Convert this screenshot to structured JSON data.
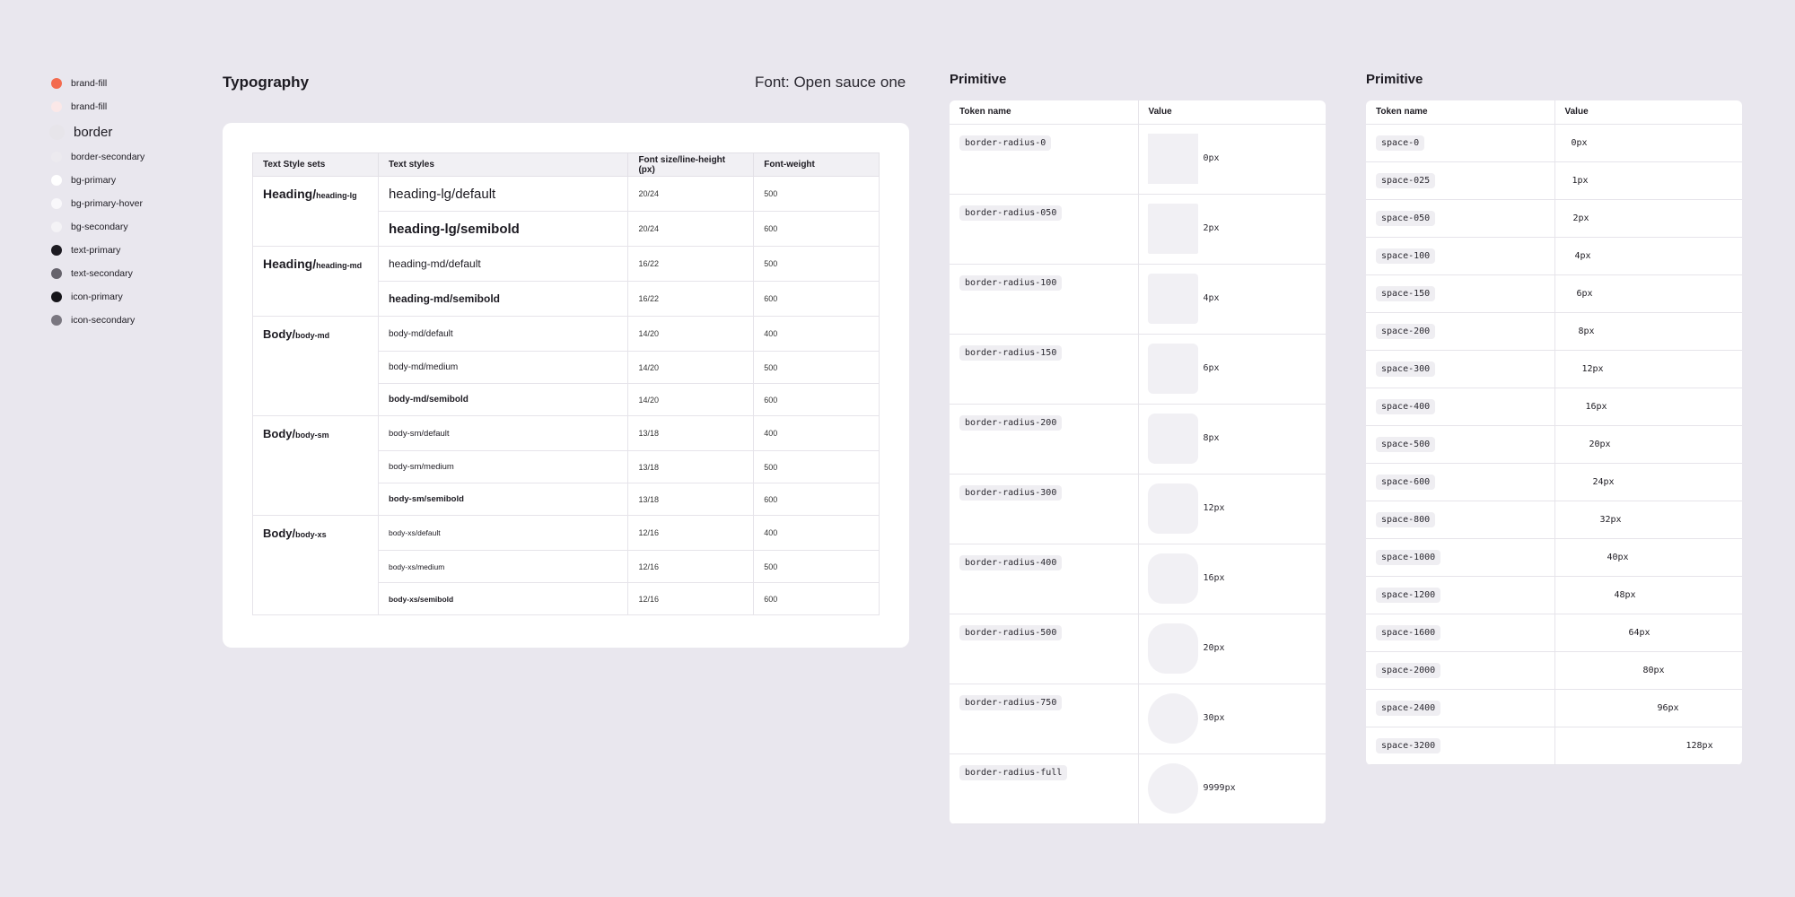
{
  "legend": [
    {
      "label": "brand-fill",
      "color": "#f36b4f"
    },
    {
      "label": "brand-fill",
      "color": "#fbe8e8"
    },
    {
      "label": "border",
      "color": "#e7e5ea"
    },
    {
      "label": "border-secondary",
      "color": "#eceaef"
    },
    {
      "label": "bg-primary",
      "color": "#ffffff"
    },
    {
      "label": "bg-primary-hover",
      "color": "#f9f8fb"
    },
    {
      "label": "bg-secondary",
      "color": "#f4f3f6"
    },
    {
      "label": "text-primary",
      "color": "#1d1b22"
    },
    {
      "label": "text-secondary",
      "color": "#66636c"
    },
    {
      "label": "icon-primary",
      "color": "#151419"
    },
    {
      "label": "icon-secondary",
      "color": "#7a7780"
    }
  ],
  "typography": {
    "title": "Typography",
    "font": "Font: Open sauce one",
    "headers": [
      "Text Style sets",
      "Text styles",
      "Font size/line-height (px)",
      "Font-weight"
    ],
    "rows": [
      {
        "set_main": "Heading/",
        "set_sub": "heading-lg",
        "style": "heading-lg/default",
        "size": "20/24",
        "weight": "500"
      },
      {
        "set_main": "",
        "set_sub": "",
        "style": "heading-lg/semibold",
        "size": "20/24",
        "weight": "600"
      },
      {
        "set_main": "Heading/",
        "set_sub": "heading-md",
        "style": "heading-md/default",
        "size": "16/22",
        "weight": "500"
      },
      {
        "set_main": "",
        "set_sub": "",
        "style": "heading-md/semibold",
        "size": "16/22",
        "weight": "600"
      },
      {
        "set_main": "Body/",
        "set_sub": "body-md",
        "style": "body-md/default",
        "size": "14/20",
        "weight": "400"
      },
      {
        "set_main": "",
        "set_sub": "",
        "style": "body-md/medium",
        "size": "14/20",
        "weight": "500"
      },
      {
        "set_main": "",
        "set_sub": "",
        "style": "body-md/semibold",
        "size": "14/20",
        "weight": "600"
      },
      {
        "set_main": "Body/",
        "set_sub": "body-sm",
        "style": "body-sm/default",
        "size": "13/18",
        "weight": "400"
      },
      {
        "set_main": "",
        "set_sub": "",
        "style": "body-sm/medium",
        "size": "13/18",
        "weight": "500"
      },
      {
        "set_main": "",
        "set_sub": "",
        "style": "body-sm/semibold",
        "size": "13/18",
        "weight": "600"
      },
      {
        "set_main": "Body/",
        "set_sub": "body-xs",
        "style": "body-xs/default",
        "size": "12/16",
        "weight": "400"
      },
      {
        "set_main": "",
        "set_sub": "",
        "style": "body-xs/medium",
        "size": "12/16",
        "weight": "500"
      },
      {
        "set_main": "",
        "set_sub": "",
        "style": "body-xs/semibold",
        "size": "12/16",
        "weight": "600"
      }
    ]
  },
  "radius": {
    "title": "Primitive",
    "headers": [
      "Token name",
      "Value"
    ],
    "rows": [
      {
        "token": "border-radius-0",
        "value": "0px"
      },
      {
        "token": "border-radius-050",
        "value": "2px"
      },
      {
        "token": "border-radius-100",
        "value": "4px"
      },
      {
        "token": "border-radius-150",
        "value": "6px"
      },
      {
        "token": "border-radius-200",
        "value": "8px"
      },
      {
        "token": "border-radius-300",
        "value": "12px"
      },
      {
        "token": "border-radius-400",
        "value": "16px"
      },
      {
        "token": "border-radius-500",
        "value": "20px"
      },
      {
        "token": "border-radius-750",
        "value": "30px"
      },
      {
        "token": "border-radius-full",
        "value": "9999px"
      }
    ]
  },
  "spacing": {
    "title": "Primitive",
    "headers": [
      "Token name",
      "Value"
    ],
    "rows": [
      {
        "token": "space-0",
        "value": "0px"
      },
      {
        "token": "space-025",
        "value": "1px"
      },
      {
        "token": "space-050",
        "value": "2px"
      },
      {
        "token": "space-100",
        "value": "4px"
      },
      {
        "token": "space-150",
        "value": "6px"
      },
      {
        "token": "space-200",
        "value": "8px"
      },
      {
        "token": "space-300",
        "value": "12px"
      },
      {
        "token": "space-400",
        "value": "16px"
      },
      {
        "token": "space-500",
        "value": "20px"
      },
      {
        "token": "space-600",
        "value": "24px"
      },
      {
        "token": "space-800",
        "value": "32px"
      },
      {
        "token": "space-1000",
        "value": "40px"
      },
      {
        "token": "space-1200",
        "value": "48px"
      },
      {
        "token": "space-1600",
        "value": "64px"
      },
      {
        "token": "space-2000",
        "value": "80px"
      },
      {
        "token": "space-2400",
        "value": "96px"
      },
      {
        "token": "space-3200",
        "value": "128px"
      }
    ]
  }
}
